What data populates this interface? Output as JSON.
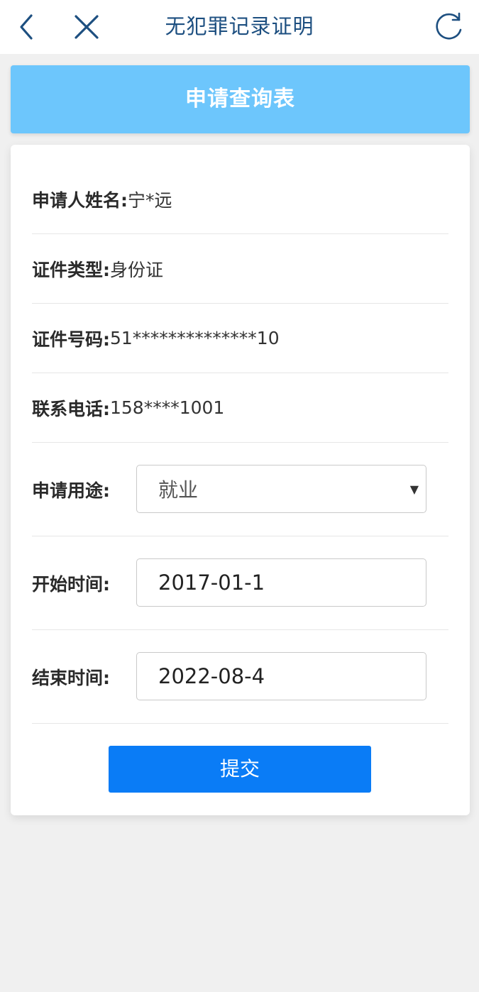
{
  "header": {
    "title": "无犯罪记录证明",
    "back_icon": "chevron-left-icon",
    "close_icon": "close-icon",
    "refresh_icon": "refresh-icon",
    "icon_color": "#1d4f80"
  },
  "banner": {
    "title": "申请查询表",
    "color": "#6dc6fc"
  },
  "form": {
    "name_label": "申请人姓名:",
    "name_value": "宁*远",
    "id_type_label": "证件类型:",
    "id_type_value": "身份证",
    "id_number_label": "证件号码:",
    "id_number_value": "51**************10",
    "phone_label": "联系电话:",
    "phone_value": "158****1001",
    "purpose_label": "申请用途:",
    "purpose_value": "就业",
    "start_label": "开始时间:",
    "start_value": "2017-01-1",
    "end_label": "结束时间:",
    "end_value": "2022-08-4",
    "submit_label": "提交",
    "submit_color": "#0a7cf6"
  }
}
